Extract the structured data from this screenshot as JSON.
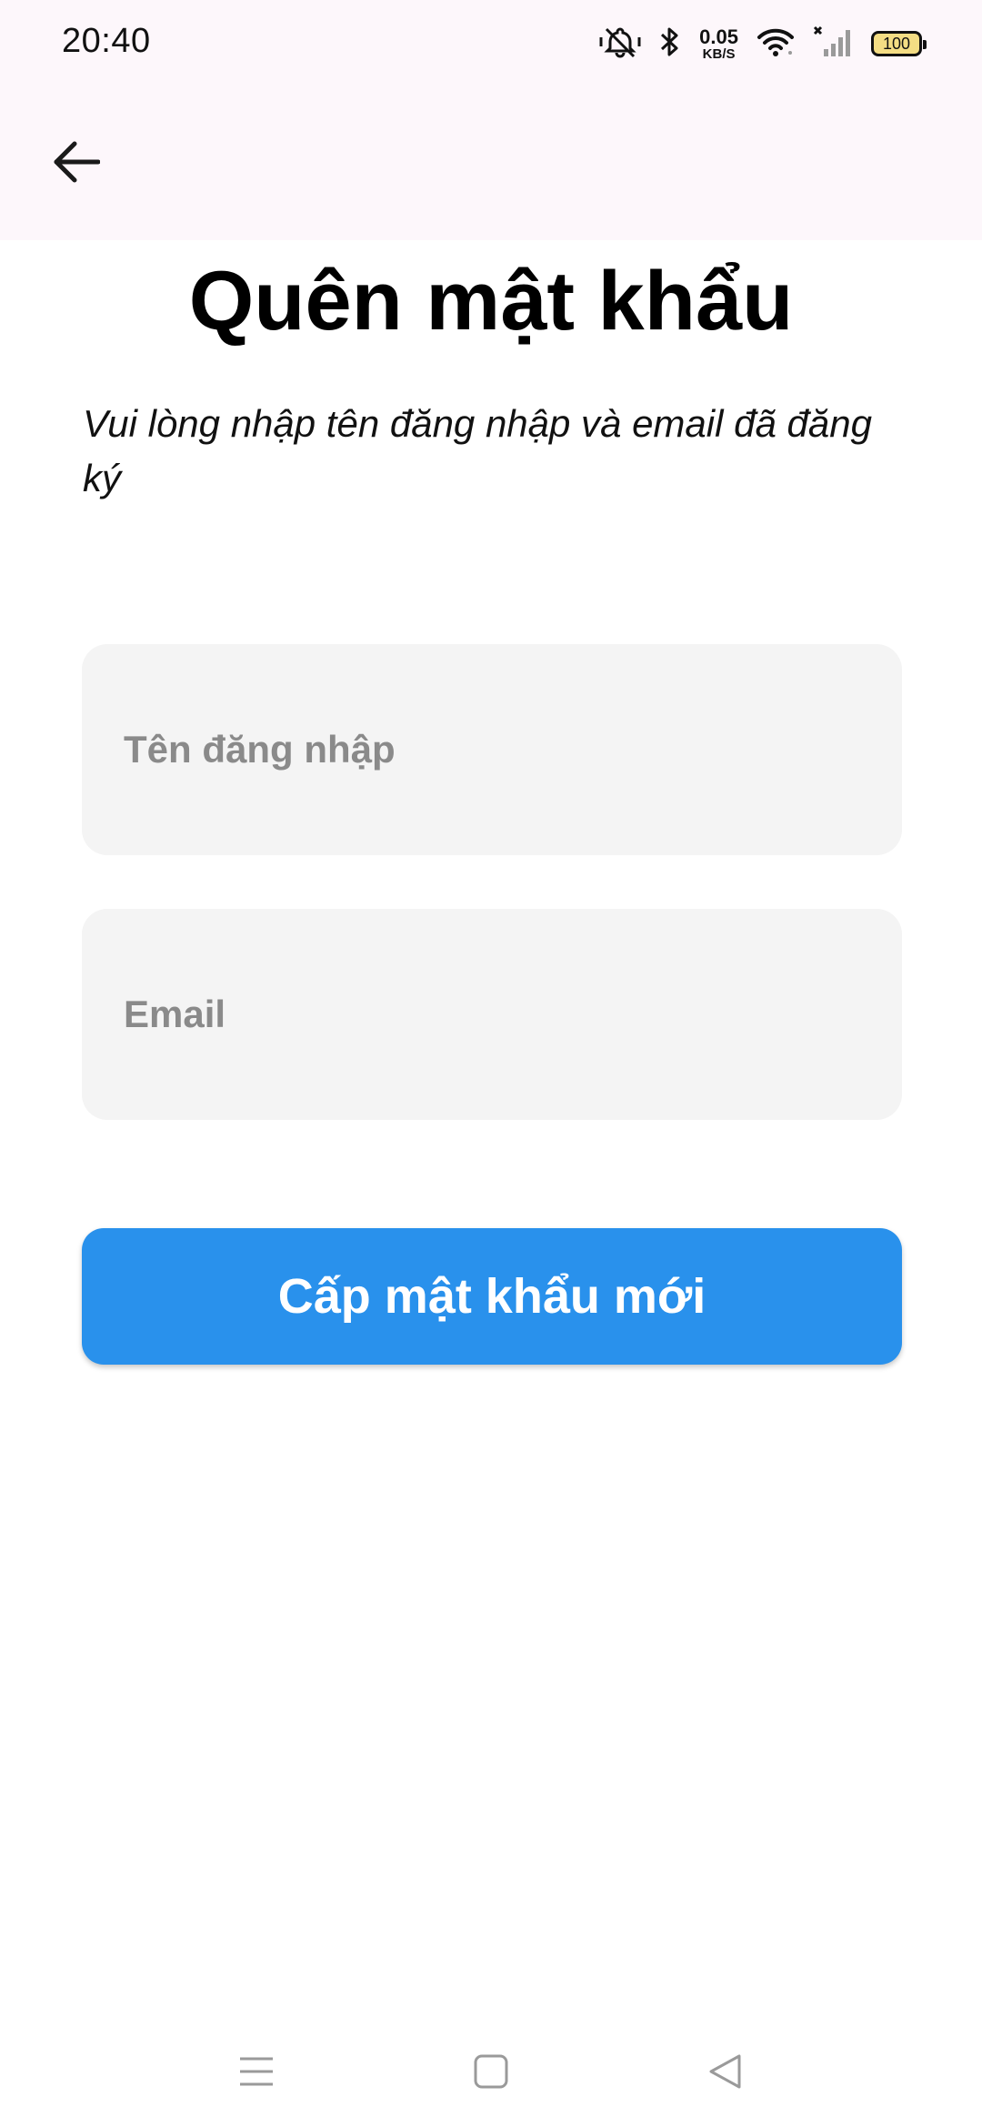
{
  "status_bar": {
    "time": "20:40",
    "net_speed_value": "0.05",
    "net_speed_unit": "KB/S",
    "battery_level": "100",
    "icons": [
      "mute-vibrate-icon",
      "bluetooth-icon",
      "wifi-icon",
      "signal-no-service-icon",
      "battery-icon"
    ]
  },
  "header": {
    "back_icon": "arrow-left-icon"
  },
  "page": {
    "title": "Quên mật khẩu",
    "instruction": "Vui lòng nhập tên đăng nhập và email đã đăng ký"
  },
  "form": {
    "username": {
      "placeholder": "Tên đăng nhập",
      "value": ""
    },
    "email": {
      "placeholder": "Email",
      "value": ""
    },
    "submit_label": "Cấp mật khẩu mới"
  },
  "nav_bar": {
    "icons": [
      "menu-icon",
      "home-square-icon",
      "back-triangle-icon"
    ]
  },
  "colors": {
    "primary": "#2991ec",
    "app_bar_bg": "#fdf7fb",
    "field_bg": "#f4f4f4",
    "placeholder": "#8a8a8a",
    "battery_fill": "#f4dd84"
  }
}
